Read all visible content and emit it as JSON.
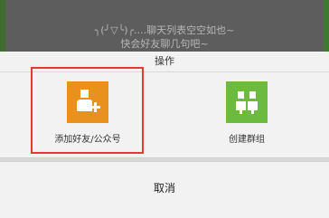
{
  "background": {
    "line1": "╮(╯▽╰)╭....聊天列表空空如也~",
    "line2": "快会好友聊几句吧~"
  },
  "sheet": {
    "title": "操作",
    "actions": [
      {
        "label": "添加好友/公众号",
        "icon": "add-friend-icon",
        "color": "#e8911f"
      },
      {
        "label": "创建群组",
        "icon": "create-group-icon",
        "color": "#6cba3f"
      }
    ],
    "cancel_label": "取消"
  },
  "highlight_color": "#e53935"
}
